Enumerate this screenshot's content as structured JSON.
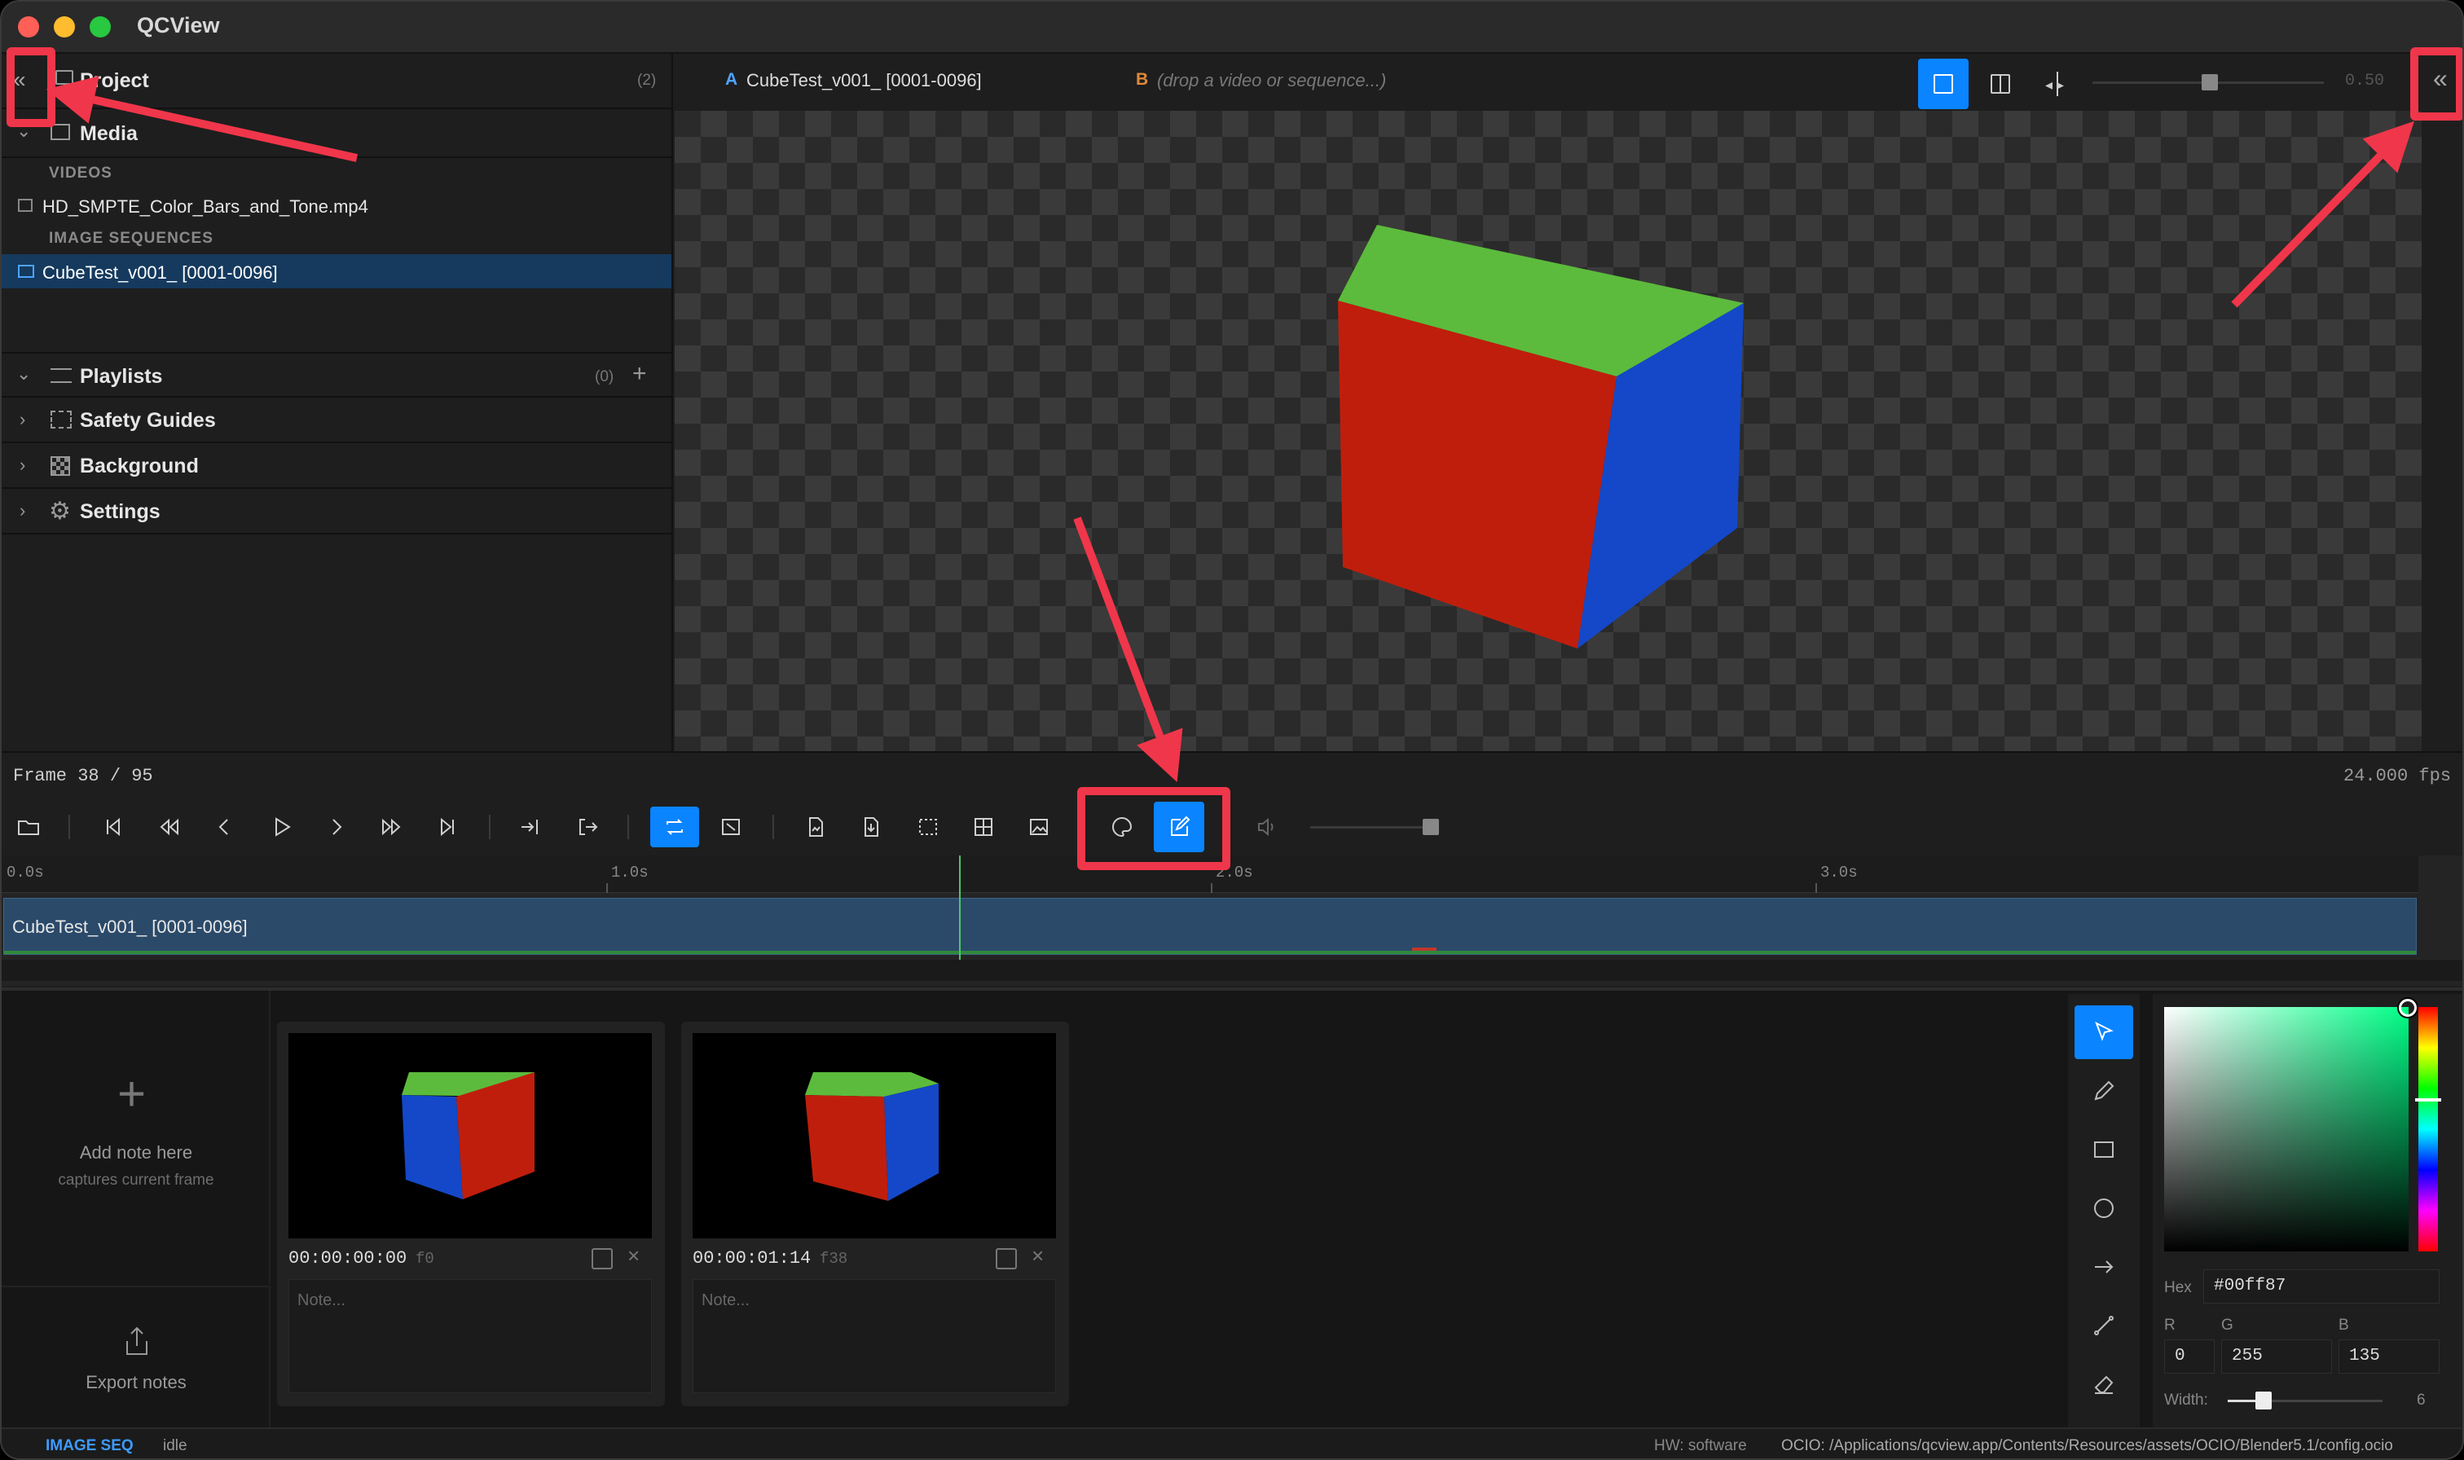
{
  "app": {
    "title": "QCView"
  },
  "sidebar": {
    "project": {
      "label": "Project",
      "count": "(2)"
    },
    "media": {
      "label": "Media"
    },
    "videos_heading": "VIDEOS",
    "video_item": "HD_SMPTE_Color_Bars_and_Tone.mp4",
    "sequences_heading": "IMAGE SEQUENCES",
    "sequence_item": "CubeTest_v001_ [0001-0096]",
    "playlists": {
      "label": "Playlists",
      "count": "(0)",
      "add": "+"
    },
    "sections": [
      "Safety Guides",
      "Background",
      "Settings"
    ]
  },
  "viewer": {
    "slot_a_letter": "A",
    "slot_a_name": "CubeTest_v001_ [0001-0096]",
    "slot_b_letter": "B",
    "slot_b_placeholder": "(drop a video or sequence...)",
    "wipe_value": "0.50"
  },
  "frame": {
    "label": "Frame 38 / 95",
    "fps": "24.000 fps"
  },
  "timeline": {
    "ticks": [
      "0.0s",
      "1.0s",
      "2.0s",
      "3.0s"
    ],
    "clip_name": "CubeTest_v001_ [0001-0096]",
    "playhead_fraction": 0.396
  },
  "notes": {
    "add_title": "Add note here",
    "add_subtitle": "captures current frame",
    "export_label": "Export notes",
    "cards": [
      {
        "timecode": "00:00:00:00",
        "frame": "f0",
        "placeholder": "Note..."
      },
      {
        "timecode": "00:00:01:14",
        "frame": "f38",
        "placeholder": "Note..."
      }
    ]
  },
  "color_picker": {
    "hex_label": "Hex",
    "hex": "#00ff87",
    "r_label": "R",
    "g_label": "G",
    "b_label": "B",
    "r": "0",
    "g": "255",
    "b": "135",
    "width_label": "Width:",
    "width_value": "6"
  },
  "status": {
    "mode": "IMAGE SEQ",
    "state": "idle",
    "hw": "HW: software",
    "ocio": "OCIO: /Applications/qcview.app/Contents/Resources/assets/OCIO/Blender5.1/config.ocio"
  },
  "colors": {
    "accent": "#0a84ff",
    "annotation_red": "#f0364a",
    "cube_top": "#5cbb3c",
    "cube_left": "#c01e0c",
    "cube_right": "#1448c8",
    "selection": "#153a5e",
    "clip": "#2b4a6a"
  }
}
